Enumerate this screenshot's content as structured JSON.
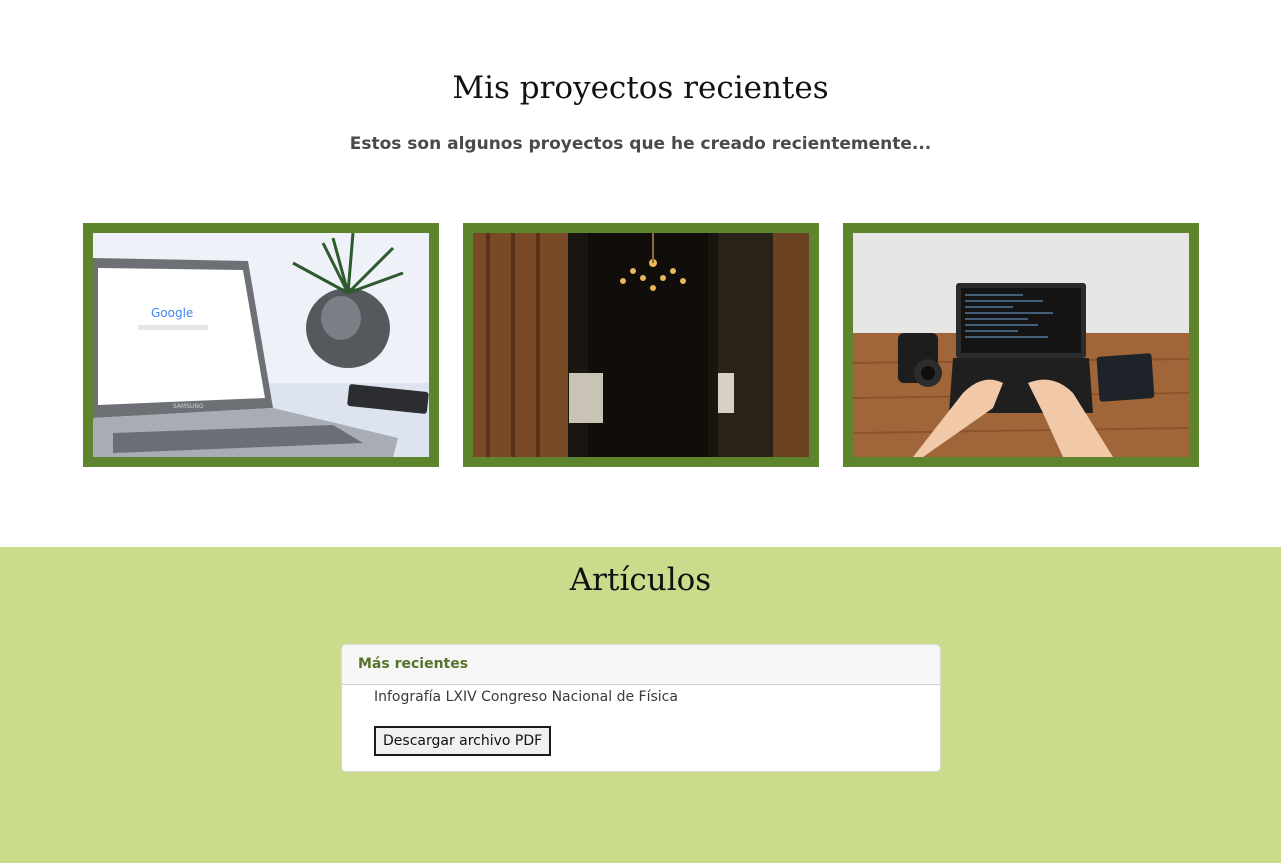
{
  "projects": {
    "title": "Mis proyectos recientes",
    "subtitle": "Estos son algunos proyectos que he creado recientemente...",
    "cards": [
      {
        "image": "laptop-google-photo"
      },
      {
        "image": "chandelier-hall-photo"
      },
      {
        "image": "laptop-coding-photo"
      }
    ],
    "frame_color": "#5e842d"
  },
  "articles": {
    "title": "Artículos",
    "background": "#cbdb8c",
    "panel": {
      "header": "Más recientes",
      "item": "Infografía LXIV Congreso Nacional de Física",
      "button_label": "Descargar archivo PDF"
    }
  }
}
